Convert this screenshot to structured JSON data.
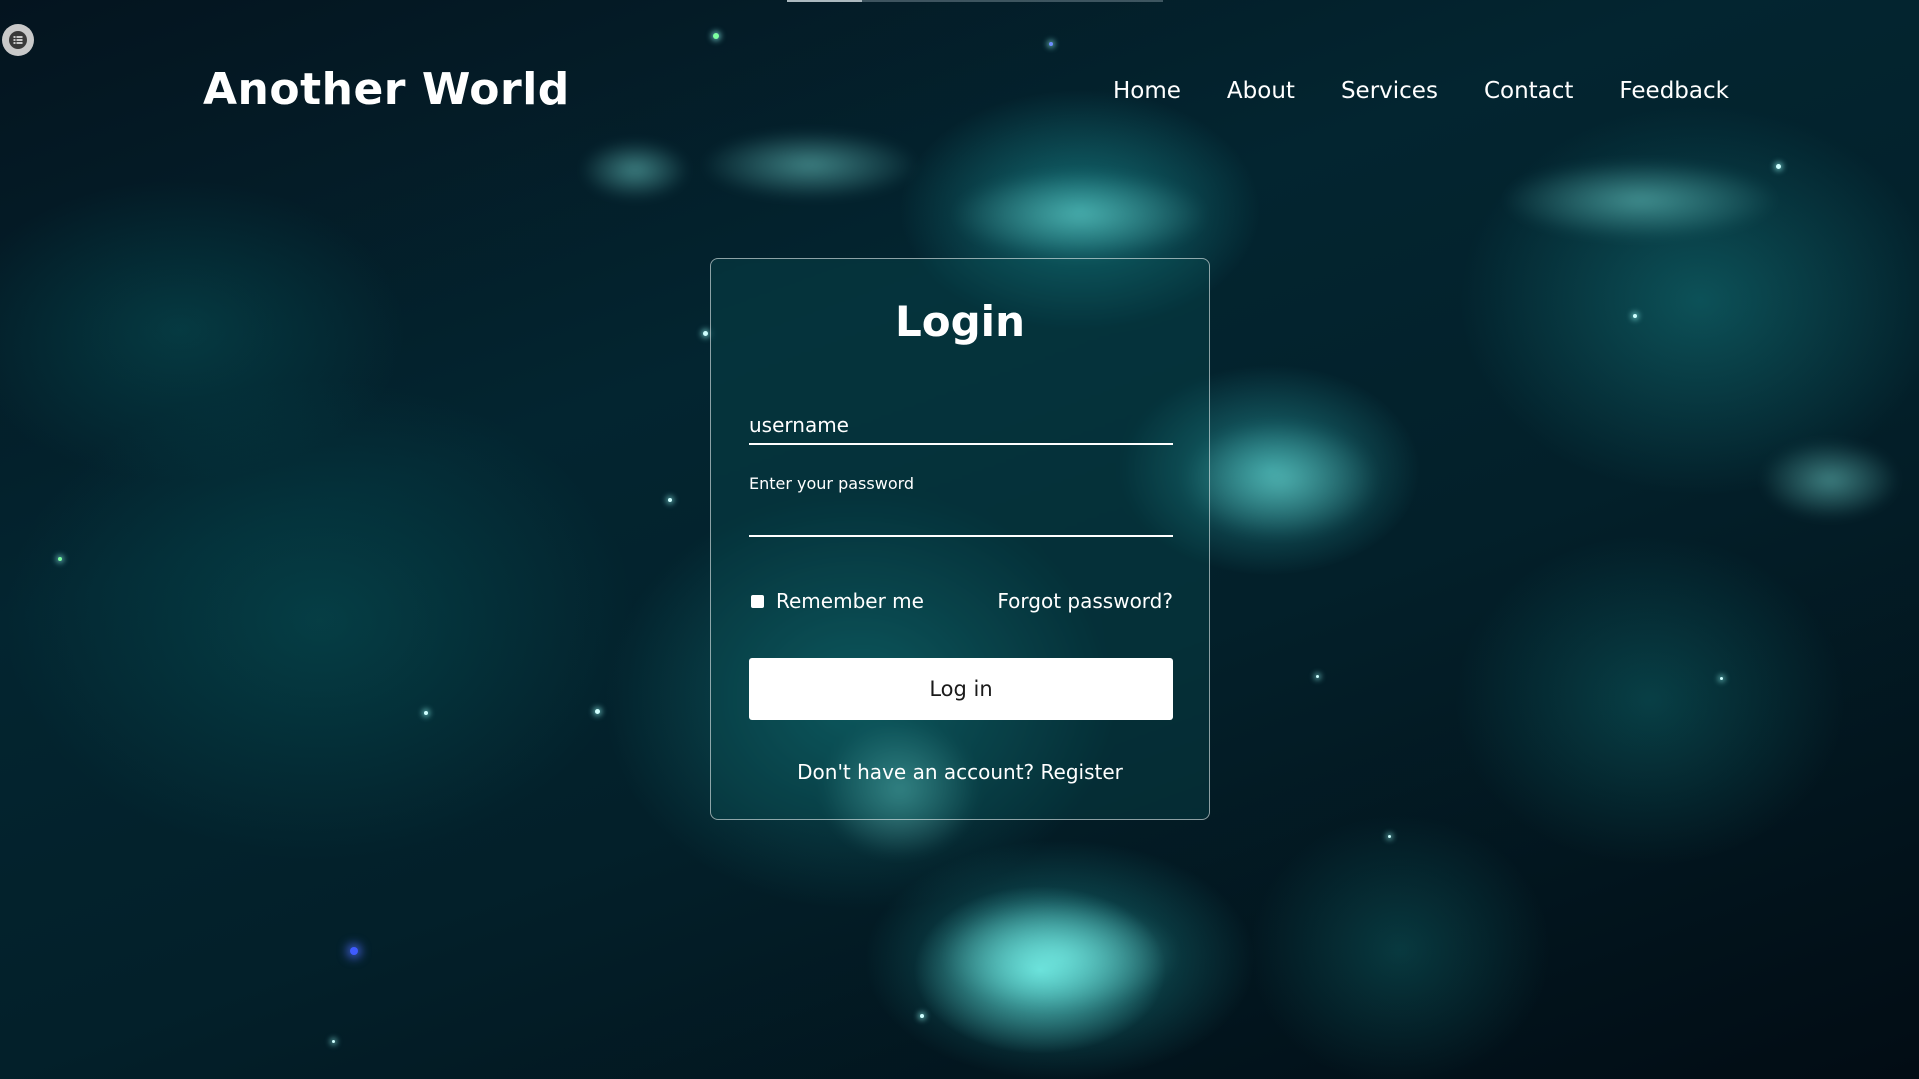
{
  "header": {
    "site_title": "Another World",
    "nav": [
      "Home",
      "About",
      "Services",
      "Contact",
      "Feedback"
    ]
  },
  "login": {
    "heading": "Login",
    "username_placeholder": "username",
    "password_label": "Enter your password",
    "remember_label": "Remember me",
    "remember_checked": false,
    "forgot_label": "Forgot password?",
    "button_label": "Log in",
    "register_prompt": "Don't have an account?",
    "register_label": "Register"
  },
  "icons": {
    "menu_toggle": "list-icon"
  },
  "colors": {
    "accent": "#1fd3cf",
    "background": "#03202a",
    "button_bg": "#ffffff",
    "button_text": "#1a1a1a"
  }
}
